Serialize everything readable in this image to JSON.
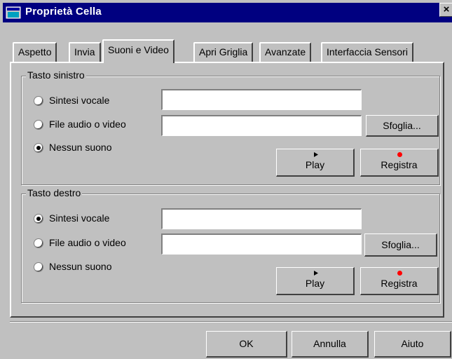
{
  "window": {
    "title": "Proprietà Cella",
    "close_glyph": "×",
    "title_icon": "app-window-icon"
  },
  "tabs": [
    {
      "label": "Aspetto",
      "active": false
    },
    {
      "label": "Invia",
      "active": false
    },
    {
      "label": "Suoni e Video",
      "active": true
    },
    {
      "label": "Apri Griglia",
      "active": false
    },
    {
      "label": "Avanzate",
      "active": false
    },
    {
      "label": "Interfaccia Sensori",
      "active": false
    }
  ],
  "left_group": {
    "title": "Tasto sinistro",
    "options": [
      {
        "label": "Sintesi vocale",
        "checked": false
      },
      {
        "label": "File audio o video",
        "checked": false
      },
      {
        "label": "Nessun suono",
        "checked": true
      }
    ],
    "speech_text": "",
    "file_path": "",
    "browse_label": "Sfoglia...",
    "play_label": "Play",
    "record_label": "Registra"
  },
  "right_group": {
    "title": "Tasto destro",
    "options": [
      {
        "label": "Sintesi vocale",
        "checked": true
      },
      {
        "label": "File audio o video",
        "checked": false
      },
      {
        "label": "Nessun suono",
        "checked": false
      }
    ],
    "speech_text": "",
    "file_path": "",
    "browse_label": "Sfoglia...",
    "play_label": "Play",
    "record_label": "Registra"
  },
  "footer": {
    "ok_label": "OK",
    "cancel_label": "Annulla",
    "help_label": "Aiuto"
  },
  "colors": {
    "title_bar": "#000080",
    "face": "#c0c0c0",
    "record_dot": "#ff0000"
  }
}
